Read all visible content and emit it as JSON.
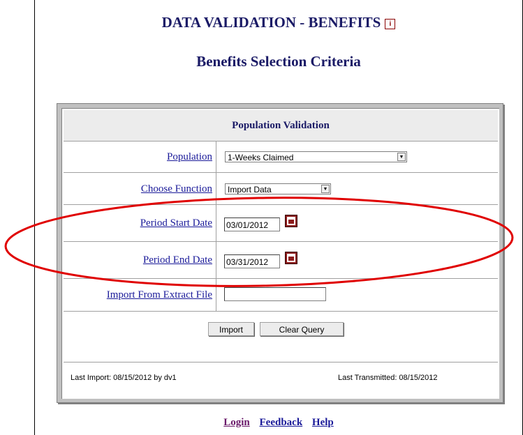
{
  "page": {
    "title": "DATA VALIDATION - BENEFITS",
    "info_icon": "i",
    "subtitle": "Benefits Selection Criteria"
  },
  "form": {
    "header": "Population Validation",
    "population": {
      "label": "Population",
      "value": "1-Weeks Claimed"
    },
    "function": {
      "label": "Choose Function",
      "value": "Import Data"
    },
    "start_date": {
      "label": "Period Start Date",
      "value": "03/01/2012"
    },
    "end_date": {
      "label": "Period End Date",
      "value": "03/31/2012"
    },
    "import_file": {
      "label": "Import From Extract File",
      "value": ""
    },
    "buttons": {
      "import": "Import",
      "clear": "Clear Query"
    },
    "footer": {
      "last_import": "Last Import: 08/15/2012 by dv1",
      "last_transmitted": "Last Transmitted: 08/15/2012"
    }
  },
  "links": [
    "Login",
    "Feedback",
    "Help"
  ],
  "colors": {
    "heading": "#1a1a66",
    "link": "#1a1a99",
    "annotation": "#e00000"
  }
}
